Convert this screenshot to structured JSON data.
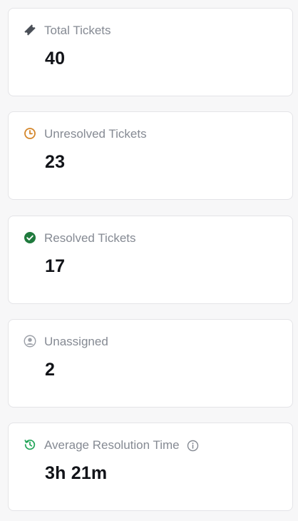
{
  "stats": [
    {
      "label": "Total Tickets",
      "value": "40",
      "icon": "ticket-icon",
      "icon_color": "#4a4f57"
    },
    {
      "label": "Unresolved Tickets",
      "value": "23",
      "icon": "clock-icon",
      "icon_color": "#d4862a"
    },
    {
      "label": "Resolved Tickets",
      "value": "17",
      "icon": "check-circle-icon",
      "icon_color": "#1f7a3d"
    },
    {
      "label": "Unassigned",
      "value": "2",
      "icon": "user-circle-icon",
      "icon_color": "#9ca0a8"
    },
    {
      "label": "Average Resolution Time",
      "value": "3h 21m",
      "icon": "history-icon",
      "icon_color": "#22a559",
      "info_icon": "info-icon"
    }
  ]
}
